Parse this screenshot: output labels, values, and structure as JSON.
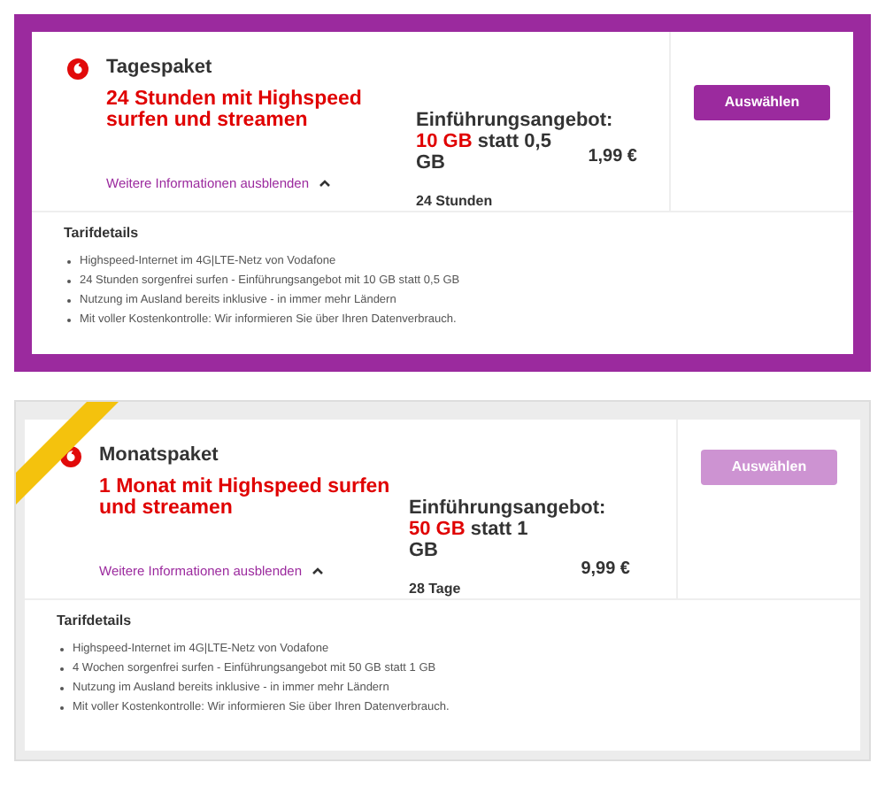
{
  "packages": [
    {
      "selected": true,
      "name": "Tagespaket",
      "headline": "24 Stunden mit Highspeed surfen und streamen",
      "offer_label": "Einführungsangebot:",
      "offer_amount": "10 GB",
      "offer_rest": "statt 0,5 GB",
      "price": "1,99 €",
      "duration": "24 Stunden",
      "toggle_link": "Weitere Informationen ausblenden",
      "expanded": true,
      "button": {
        "label": "Auswählen",
        "disabled": false
      },
      "ribbon": false,
      "details_title": "Tarifdetails",
      "details": [
        "Highspeed-Internet im 4G|LTE-Netz von Vodafone",
        "24 Stunden sorgenfrei surfen - Einführungsangebot mit 10 GB statt 0,5 GB",
        "Nutzung im Ausland bereits inklusive - in immer mehr Ländern",
        "Mit voller Kostenkontrolle: Wir informieren Sie über Ihren Datenverbrauch."
      ]
    },
    {
      "selected": false,
      "name": "Monatspaket",
      "headline": "1 Monat mit Highspeed surfen und streamen",
      "offer_label": "Einführungsangebot:",
      "offer_amount": "50 GB",
      "offer_rest": "statt 1 GB",
      "price": "9,99 €",
      "duration": "28 Tage",
      "toggle_link": "Weitere Informationen ausblenden",
      "expanded": true,
      "button": {
        "label": "Auswählen",
        "disabled": true
      },
      "ribbon": true,
      "details_title": "Tarifdetails",
      "details": [
        "Highspeed-Internet im 4G|LTE-Netz von Vodafone",
        "4 Wochen sorgenfrei surfen - Einführungsangebot mit 50 GB statt 1 GB",
        "Nutzung im Ausland bereits inklusive - in immer mehr Ländern",
        "Mit voller Kostenkontrolle: Wir informieren Sie über Ihren Datenverbrauch."
      ]
    }
  ]
}
